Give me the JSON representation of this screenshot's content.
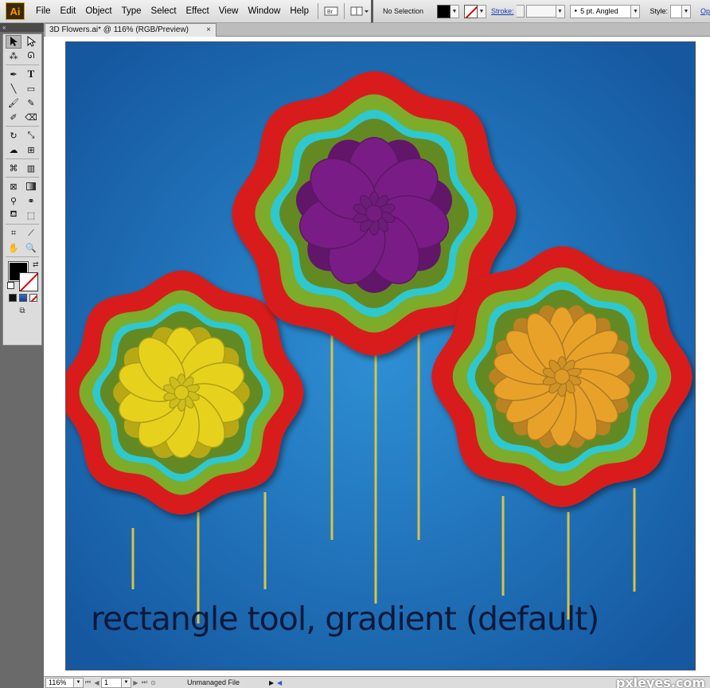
{
  "app": {
    "logo": "Ai"
  },
  "menu": [
    "File",
    "Edit",
    "Object",
    "Type",
    "Select",
    "Effect",
    "View",
    "Window",
    "Help"
  ],
  "menubar_icons": {
    "bridge": "bridge-icon",
    "arrange": "arrange-documents-icon"
  },
  "control": {
    "selection_label": "No Selection",
    "stroke_label": "Stroke:",
    "brush_value": "5 pt. Angled",
    "style_label": "Style:",
    "opacity_label": "Op"
  },
  "document": {
    "tab_title": "3D Flowers.ai* @ 116% (RGB/Preview)",
    "tab_close": "×"
  },
  "canvas": {
    "caption": "rectangle tool, gradient (default)",
    "background_color": "#1d68b0",
    "flowers": [
      {
        "name": "yellow",
        "petal_color": "#e6d21e",
        "petal_count": 10,
        "stems": 3
      },
      {
        "name": "purple",
        "petal_color": "#7a1e86",
        "petal_count": 7,
        "stems": 3
      },
      {
        "name": "orange",
        "petal_color": "#e8a22a",
        "petal_count": 14,
        "stems": 3
      }
    ],
    "ring_colors": {
      "outer": "#d81e1e",
      "middle": "#7cac2c",
      "inner": "#2ec8d0"
    },
    "stem_color": "#d8c24a"
  },
  "status": {
    "zoom": "116%",
    "page": "1",
    "file_state": "Unmanaged File",
    "watermark": "pxleyes.com"
  },
  "tools": {
    "rows": [
      [
        "selection-tool",
        "direct-selection-tool"
      ],
      [
        "magic-wand-tool",
        "lasso-tool"
      ],
      [
        "pen-tool",
        "type-tool"
      ],
      [
        "line-segment-tool",
        "rectangle-tool"
      ],
      [
        "paintbrush-tool",
        "pencil-tool"
      ],
      [
        "blob-brush-tool",
        "eraser-tool"
      ],
      [
        "rotate-tool",
        "scale-tool"
      ],
      [
        "warp-tool",
        "free-transform-tool"
      ],
      [
        "symbol-sprayer-tool",
        "column-graph-tool"
      ],
      [
        "mesh-tool",
        "gradient-tool"
      ],
      [
        "eyedropper-tool",
        "blend-tool"
      ],
      [
        "live-paint-bucket-tool",
        "live-paint-selection-tool"
      ],
      [
        "artboard-tool",
        "slice-tool"
      ],
      [
        "hand-tool",
        "zoom-tool"
      ]
    ]
  }
}
